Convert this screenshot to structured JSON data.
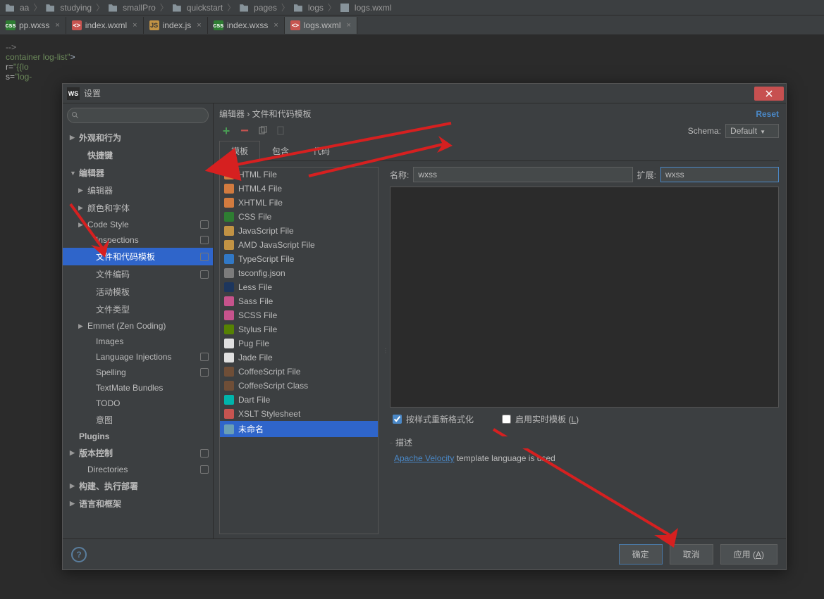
{
  "breadcrumb": [
    "aa",
    "studying",
    "smallPro",
    "quickstart",
    "pages",
    "logs",
    "logs.wxml"
  ],
  "tabs": [
    {
      "label": "pp.wxss",
      "type": "css",
      "active": false
    },
    {
      "label": "index.wxml",
      "type": "wxml",
      "active": false
    },
    {
      "label": "index.js",
      "type": "js",
      "active": false
    },
    {
      "label": "index.wxss",
      "type": "css",
      "active": false
    },
    {
      "label": "logs.wxml",
      "type": "wxml",
      "active": true
    }
  ],
  "editor_lines": {
    "l1": "-->",
    "l2_pre": "container log-list\"",
    "l2_end": ">",
    "l3": "r=\"{{lo",
    "l4": "s=\"log-"
  },
  "dialog": {
    "title": "设置",
    "logo": "WS",
    "breadcrumb": "编辑器 › 文件和代码模板",
    "reset": "Reset",
    "schema_label": "Schema:",
    "schema_value": "Default",
    "subtabs": [
      "模板",
      "包含",
      "代码"
    ],
    "name_label": "名称:",
    "name_value": "wxss",
    "ext_label": "扩展:",
    "ext_value": "wxss",
    "chk_reformat": "按样式重新格式化",
    "chk_live": "启用实时模板",
    "chk_live_u": "L",
    "desc_label": "描述",
    "desc_link": "Apache Velocity",
    "desc_text": " template language is used",
    "help": "?",
    "btn_ok": "确定",
    "btn_cancel": "取消",
    "btn_apply": "应用 ",
    "btn_apply_u": "A"
  },
  "sidebar": {
    "items": [
      {
        "label": "外观和行为",
        "arrow": "right",
        "bold": true
      },
      {
        "label": "快捷键",
        "ind": "ind1",
        "bold": true
      },
      {
        "label": "编辑器",
        "arrow": "down",
        "bold": true
      },
      {
        "label": "编辑器",
        "arrow": "right",
        "ind": "ind1"
      },
      {
        "label": "颜色和字体",
        "arrow": "right",
        "ind": "ind1"
      },
      {
        "label": "Code Style",
        "arrow": "right",
        "ind": "ind1",
        "badge": true
      },
      {
        "label": "Inspections",
        "ind": "ind2",
        "badge": true
      },
      {
        "label": "文件和代码模板",
        "ind": "ind2",
        "sel": true,
        "badge": true
      },
      {
        "label": "文件编码",
        "ind": "ind2",
        "badge": true
      },
      {
        "label": "活动模板",
        "ind": "ind2"
      },
      {
        "label": "文件类型",
        "ind": "ind2"
      },
      {
        "label": "Emmet (Zen Coding)",
        "arrow": "right",
        "ind": "ind1"
      },
      {
        "label": "Images",
        "ind": "ind2"
      },
      {
        "label": "Language Injections",
        "ind": "ind2",
        "badge": true
      },
      {
        "label": "Spelling",
        "ind": "ind2",
        "badge": true
      },
      {
        "label": "TextMate Bundles",
        "ind": "ind2"
      },
      {
        "label": "TODO",
        "ind": "ind2"
      },
      {
        "label": "意图",
        "ind": "ind2"
      },
      {
        "label": "Plugins",
        "bold": true
      },
      {
        "label": "版本控制",
        "arrow": "right",
        "bold": true,
        "badge": true
      },
      {
        "label": "Directories",
        "ind": "ind1",
        "badge": true
      },
      {
        "label": "构建、执行部署",
        "arrow": "right",
        "bold": true
      },
      {
        "label": "语言和框架",
        "arrow": "right",
        "bold": true
      }
    ]
  },
  "templates": [
    {
      "label": "HTML File",
      "ic": "h5"
    },
    {
      "label": "HTML4 File",
      "ic": "h4"
    },
    {
      "label": "XHTML File",
      "ic": "xhtml"
    },
    {
      "label": "CSS File",
      "ic": "css"
    },
    {
      "label": "JavaScript File",
      "ic": "js"
    },
    {
      "label": "AMD JavaScript File",
      "ic": "js"
    },
    {
      "label": "TypeScript File",
      "ic": "ts"
    },
    {
      "label": "tsconfig.json",
      "ic": "json"
    },
    {
      "label": "Less File",
      "ic": "less"
    },
    {
      "label": "Sass File",
      "ic": "sass"
    },
    {
      "label": "SCSS File",
      "ic": "scss"
    },
    {
      "label": "Stylus File",
      "ic": "styl"
    },
    {
      "label": "Pug File",
      "ic": "pug"
    },
    {
      "label": "Jade File",
      "ic": "jade"
    },
    {
      "label": "CoffeeScript File",
      "ic": "coffee"
    },
    {
      "label": "CoffeeScript Class",
      "ic": "coffee"
    },
    {
      "label": "Dart File",
      "ic": "dart"
    },
    {
      "label": "XSLT Stylesheet",
      "ic": "xslt"
    },
    {
      "label": "未命名",
      "ic": "unk",
      "sel": true
    }
  ]
}
